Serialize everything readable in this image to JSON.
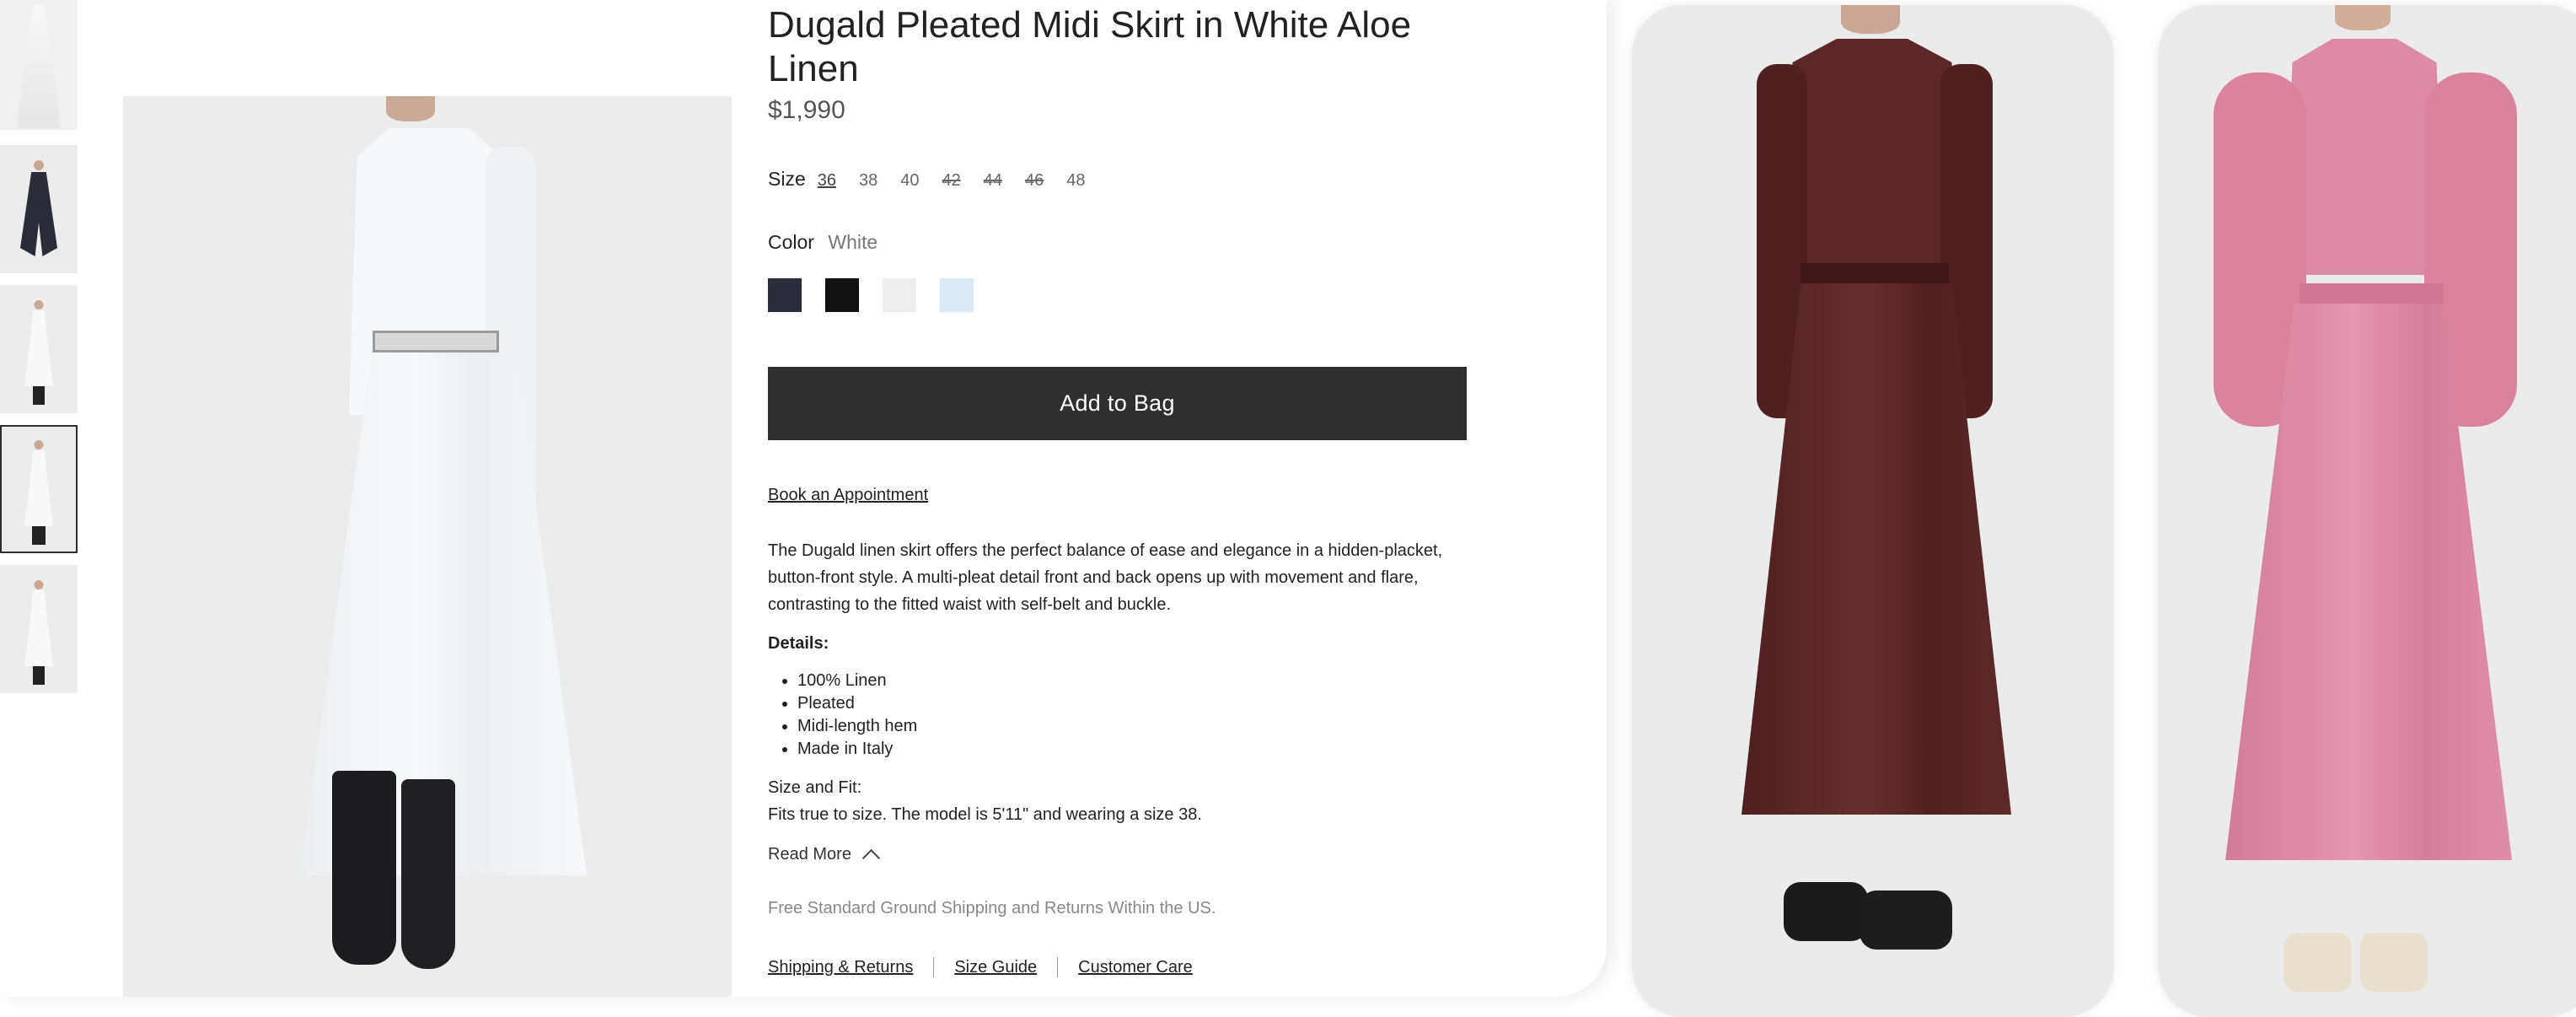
{
  "product": {
    "title": "Dugald Pleated Midi Skirt in White Aloe Linen",
    "price": "$1,990"
  },
  "size": {
    "label": "Size",
    "options": [
      {
        "label": "36",
        "state": "selected"
      },
      {
        "label": "38",
        "state": "available"
      },
      {
        "label": "40",
        "state": "available"
      },
      {
        "label": "42",
        "state": "unavailable"
      },
      {
        "label": "44",
        "state": "unavailable"
      },
      {
        "label": "46",
        "state": "unavailable"
      },
      {
        "label": "48",
        "state": "available"
      }
    ]
  },
  "color": {
    "label": "Color",
    "selected": "White",
    "swatches": [
      "#2b2d3b",
      "#111111",
      "#eeeeee",
      "#dde8f5"
    ]
  },
  "actions": {
    "add_to_bag": "Add to Bag",
    "book_appointment": "Book an Appointment",
    "read_more": "Read More"
  },
  "description": "The Dugald linen skirt offers the perfect balance of ease and elegance in a hidden-placket, button-front style. A multi-pleat detail front and back opens up with movement and flare, contrasting to the fitted waist with self-belt and buckle.",
  "details": {
    "heading": "Details:",
    "items": [
      "100% Linen",
      "Pleated",
      "Midi-length hem",
      "Made in Italy"
    ]
  },
  "fit": {
    "heading": "Size and Fit:",
    "text": "Fits true to size. The model is 5'11\" and wearing a size 38."
  },
  "shipping_note": "Free Standard Ground Shipping and Returns Within the US.",
  "footer_links": [
    "Shipping & Returns",
    "Size Guide",
    "Customer Care"
  ],
  "colors": {
    "button": "#2f2f2f",
    "outfit_white": "#f2f4f6",
    "outfit_burgundy": "#5a2628",
    "outfit_pink": "#dd8aa6"
  }
}
